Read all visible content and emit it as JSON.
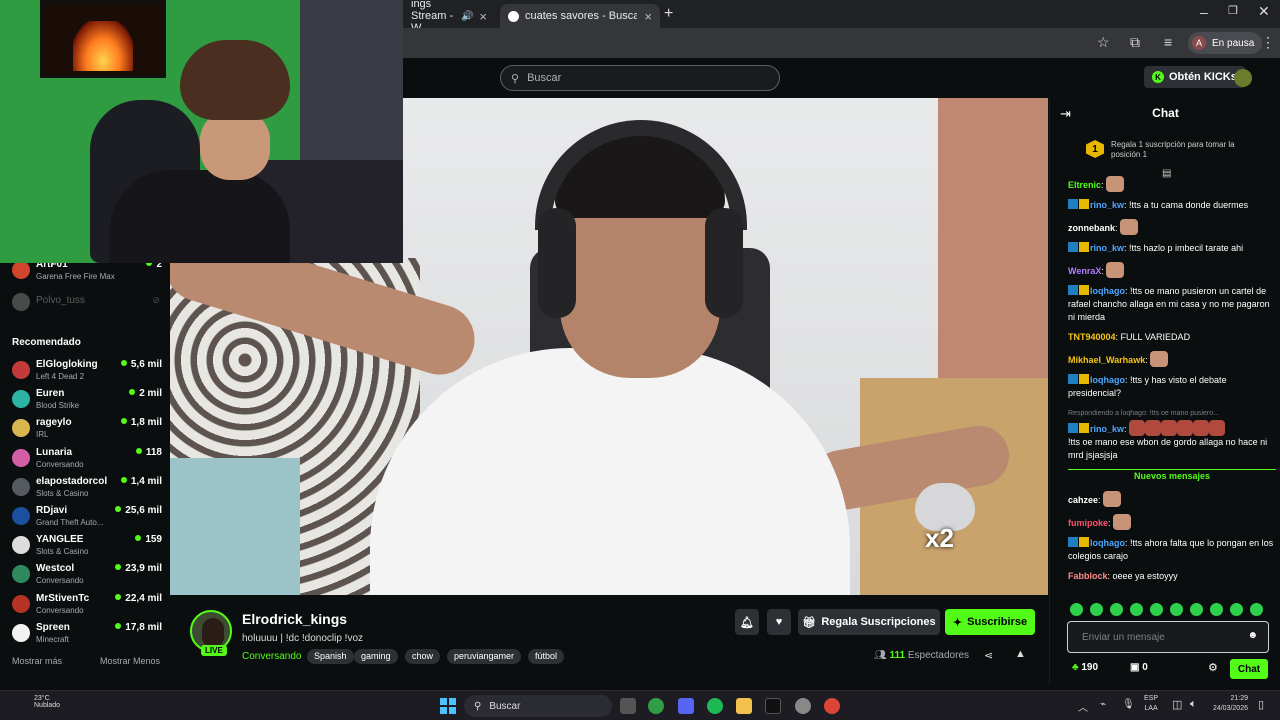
{
  "browser": {
    "tabs": [
      {
        "label": "ings Stream - W",
        "active": false
      },
      {
        "label": "cuates savores - Buscar con Go",
        "active": true
      }
    ],
    "profile_initial": "A",
    "profile_status": "En pausa"
  },
  "header": {
    "search_placeholder": "Buscar",
    "kicks_button": "Obtén KICKs"
  },
  "sidebar": {
    "followed": [
      {
        "name": "ArtF01",
        "game": "Garena Free Fire Max",
        "count": "2"
      },
      {
        "name": "Polvo_tuss",
        "game": "",
        "count": ""
      }
    ],
    "recommended_title": "Recomendado",
    "recommended": [
      {
        "name": "ElGlogloking",
        "game": "Left 4 Dead 2",
        "count": "5,6 mil",
        "color": "#c23b3b"
      },
      {
        "name": "Euren",
        "game": "Blood Strike",
        "count": "2 mil",
        "color": "#2bb3a3"
      },
      {
        "name": "rageylo",
        "game": "IRL",
        "count": "1,8 mil",
        "color": "#d9b64f"
      },
      {
        "name": "Lunaria",
        "game": "Conversando",
        "count": "118",
        "color": "#d25fa6"
      },
      {
        "name": "elapostadorcol",
        "game": "Slots & Casino",
        "count": "1,4 mil",
        "color": "#555a60"
      },
      {
        "name": "RDjavi",
        "game": "Grand Theft Auto...",
        "count": "25,6 mil",
        "color": "#1c4fa0"
      },
      {
        "name": "YANGLEE",
        "game": "Slots & Casino",
        "count": "159",
        "color": "#dddddd"
      },
      {
        "name": "Westcol",
        "game": "Conversando",
        "count": "23,9 mil",
        "color": "#2e8a5e"
      },
      {
        "name": "MrStivenTc",
        "game": "Conversando",
        "count": "22,4 mil",
        "color": "#b53324"
      },
      {
        "name": "Spreen",
        "game": "Minecraft",
        "count": "17,8 mil",
        "color": "#f2f2f2"
      }
    ],
    "show_more": "Mostrar más",
    "show_less": "Mostrar Menos"
  },
  "stream": {
    "streamer": "Elrodrick_kings",
    "live": "LIVE",
    "title": "holuuuu | !dc !donoclip !voz",
    "category": "Conversando",
    "tags": [
      "Spanish",
      "gaming",
      "chow",
      "peruviangamer",
      "fútbol"
    ],
    "gift_button": "Regala Suscripciones",
    "subscribe_button": "Suscribirse",
    "viewers_count": "111",
    "viewers_label": "Espectadores",
    "overlay_text": "x2"
  },
  "chat": {
    "title": "Chat",
    "pinned": "Regala 1 suscripción para tomar la posición 1",
    "pinned_rank": "1",
    "messages": [
      {
        "user": "Eltrenic",
        "color": "#53fc18",
        "text": ""
      },
      {
        "user": "rino_kw",
        "color": "#4aa8ff",
        "text": "!tts a tu cama donde duermes"
      },
      {
        "user": "zonnebank",
        "color": "#ffffff",
        "text": ""
      },
      {
        "user": "rino_kw",
        "color": "#4aa8ff",
        "text": "!tts hazlo p imbecil tarate ahi"
      },
      {
        "user": "WenraX",
        "color": "#b57cff",
        "text": ""
      },
      {
        "user": "loqhago",
        "color": "#4aa8ff",
        "text": "!tts oe mano pusieron un cartel de rafael chancho allaga en mi casa y no me pagaron ni mierda"
      },
      {
        "user": "TNT940004",
        "color": "#f5c518",
        "text": "FULL VARIEDAD"
      },
      {
        "user": "Mikhael_Warhawk",
        "color": "#f5c518",
        "text": ""
      },
      {
        "user": "loqhago",
        "color": "#4aa8ff",
        "text": "!tts y has visto el debate presidencial?"
      }
    ],
    "reply_hint": "Respondiendo a loqhago: !tts oe mano pusiero...",
    "reply_user": "rino_kw",
    "reply_text": "!tts oe mano ese wbon de gordo allaga no hace ni mrd jsjasjsja",
    "new_messages": "Nuevos mensajes",
    "messages2": [
      {
        "user": "cahzee",
        "color": "#ffffff",
        "text": ""
      },
      {
        "user": "fumipoke",
        "color": "#ff4f6d",
        "text": ""
      },
      {
        "user": "loqhago",
        "color": "#4aa8ff",
        "text": "!tts ahora falta que lo pongan en los colegios carajo"
      },
      {
        "user": "Fabblock",
        "color": "#ff8a8a",
        "text": "oeee ya estoyyy"
      }
    ],
    "input_placeholder": "Enviar un mensaje",
    "kicks_count": "190",
    "gift_count": "0",
    "send_button": "Chat"
  },
  "taskbar": {
    "weather_temp": "23°C",
    "weather_desc": "Nublado",
    "search": "Buscar",
    "lang1": "ESP",
    "lang2": "LAA",
    "time": "21:29",
    "date": "24/03/2026"
  }
}
